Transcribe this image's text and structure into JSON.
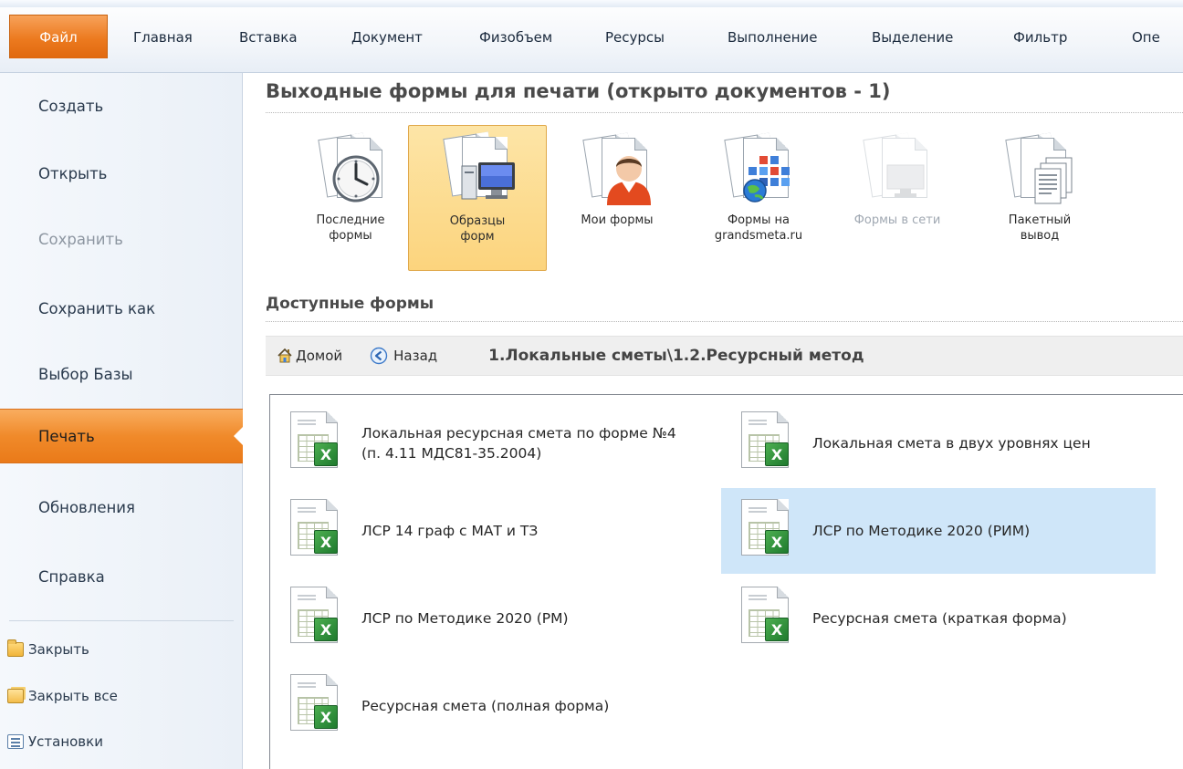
{
  "ribbon": {
    "tabs": [
      "Файл",
      "Главная",
      "Вставка",
      "Документ",
      "Физобъем",
      "Ресурсы",
      "Выполнение",
      "Выделение",
      "Фильтр",
      "Опе"
    ],
    "active_tab": "Файл",
    "accent": "#ec7a1f"
  },
  "backstage": {
    "items": [
      {
        "label": "Создать",
        "enabled": true
      },
      {
        "label": "Открыть",
        "enabled": true
      },
      {
        "label": "Сохранить",
        "enabled": false
      },
      {
        "label": "Сохранить как",
        "enabled": true
      },
      {
        "label": "Выбор Базы",
        "enabled": true
      },
      {
        "label": "Печать",
        "enabled": true,
        "active": true
      },
      {
        "label": "Обновления",
        "enabled": true
      },
      {
        "label": "Справка",
        "enabled": true
      }
    ],
    "small_items": [
      {
        "label": "Закрыть",
        "icon": "folder-icon"
      },
      {
        "label": "Закрыть все",
        "icon": "folders-icon"
      },
      {
        "label": "Установки",
        "icon": "settings-icon"
      }
    ]
  },
  "print": {
    "title": "Выходные формы для печати (открыто документов - 1)",
    "buttons": [
      {
        "label": "Последние\nформы",
        "icon": "recent-clock-icon",
        "selected": false,
        "enabled": true
      },
      {
        "label": "Образцы\nформ",
        "icon": "computer-icon",
        "selected": true,
        "enabled": true
      },
      {
        "label": "Мои формы",
        "icon": "user-icon",
        "selected": false,
        "enabled": true
      },
      {
        "label": "Формы на\ngrandsmeta.ru",
        "icon": "web-forms-icon",
        "selected": false,
        "enabled": true
      },
      {
        "label": "Формы в сети",
        "icon": "network-icon",
        "selected": false,
        "enabled": false
      },
      {
        "label": "Пакетный\nвывод",
        "icon": "batch-pages-icon",
        "selected": false,
        "enabled": true
      }
    ],
    "available_title": "Доступные формы",
    "nav": {
      "home": "Домой",
      "back": "Назад",
      "path": "1.Локальные сметы\\1.2.Ресурсный метод"
    },
    "forms": [
      {
        "name": "Локальная ресурсная смета по форме №4 (п. 4.11 МДС81-35.2004)",
        "selected": false
      },
      {
        "name": "Локальная смета в двух уровнях цен",
        "selected": false
      },
      {
        "name": "ЛСР 14 граф с МАТ и ТЗ",
        "selected": false
      },
      {
        "name": "ЛСР по Методике 2020 (РИМ)",
        "selected": true
      },
      {
        "name": "ЛСР по Методике 2020 (РМ)",
        "selected": false
      },
      {
        "name": "Ресурсная смета (краткая форма)",
        "selected": false
      },
      {
        "name": "Ресурсная смета (полная форма)",
        "selected": false
      }
    ],
    "file_badge": "X"
  }
}
